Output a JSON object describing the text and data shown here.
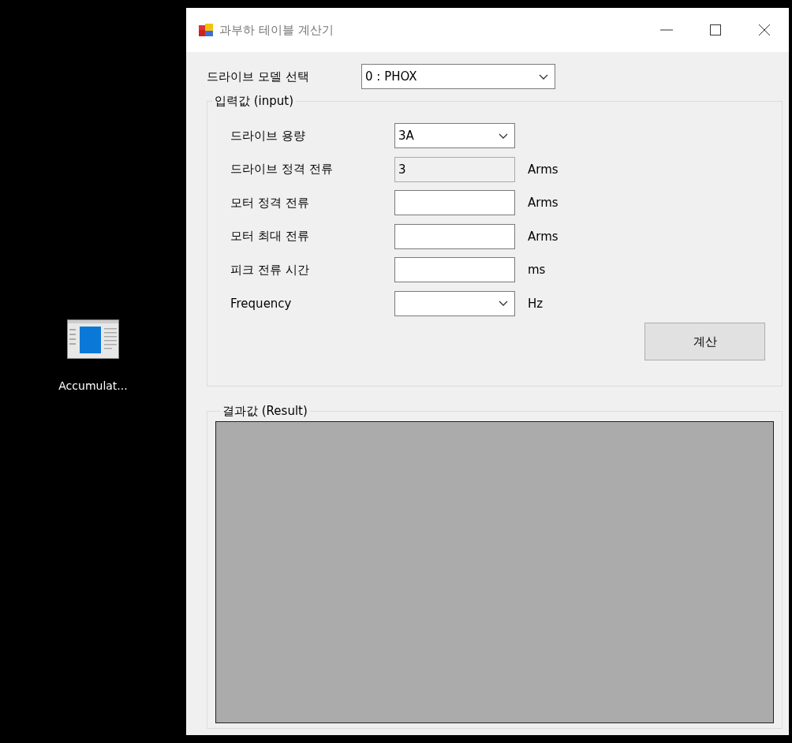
{
  "desktop": {
    "icons": [
      {
        "label": "Accumulat..."
      }
    ]
  },
  "window": {
    "title": "과부하 테이블 계산기"
  },
  "model": {
    "label": "드라이브 모델 선택",
    "value": "0 : PHOX"
  },
  "input_group": {
    "title": "입력값 (input)",
    "fields": [
      {
        "label": "드라이브 용량",
        "kind": "combo",
        "value": "3A",
        "disabled": false
      },
      {
        "label": "드라이브 정격 전류",
        "kind": "text",
        "value": "3",
        "unit": "Arms",
        "disabled": true
      },
      {
        "label": "모터 정격 전류",
        "kind": "text",
        "unit": "Arms",
        "disabled": false
      },
      {
        "label": "모터 최대 전류",
        "kind": "text",
        "unit": "Arms",
        "disabled": false
      },
      {
        "label": "피크 전류 시간",
        "kind": "text",
        "unit": "ms",
        "disabled": false
      },
      {
        "label": "Frequency",
        "kind": "combo",
        "unit": "Hz",
        "disabled": false
      }
    ],
    "button": "계산"
  },
  "result_group": {
    "title": "결과값 (Result)"
  }
}
